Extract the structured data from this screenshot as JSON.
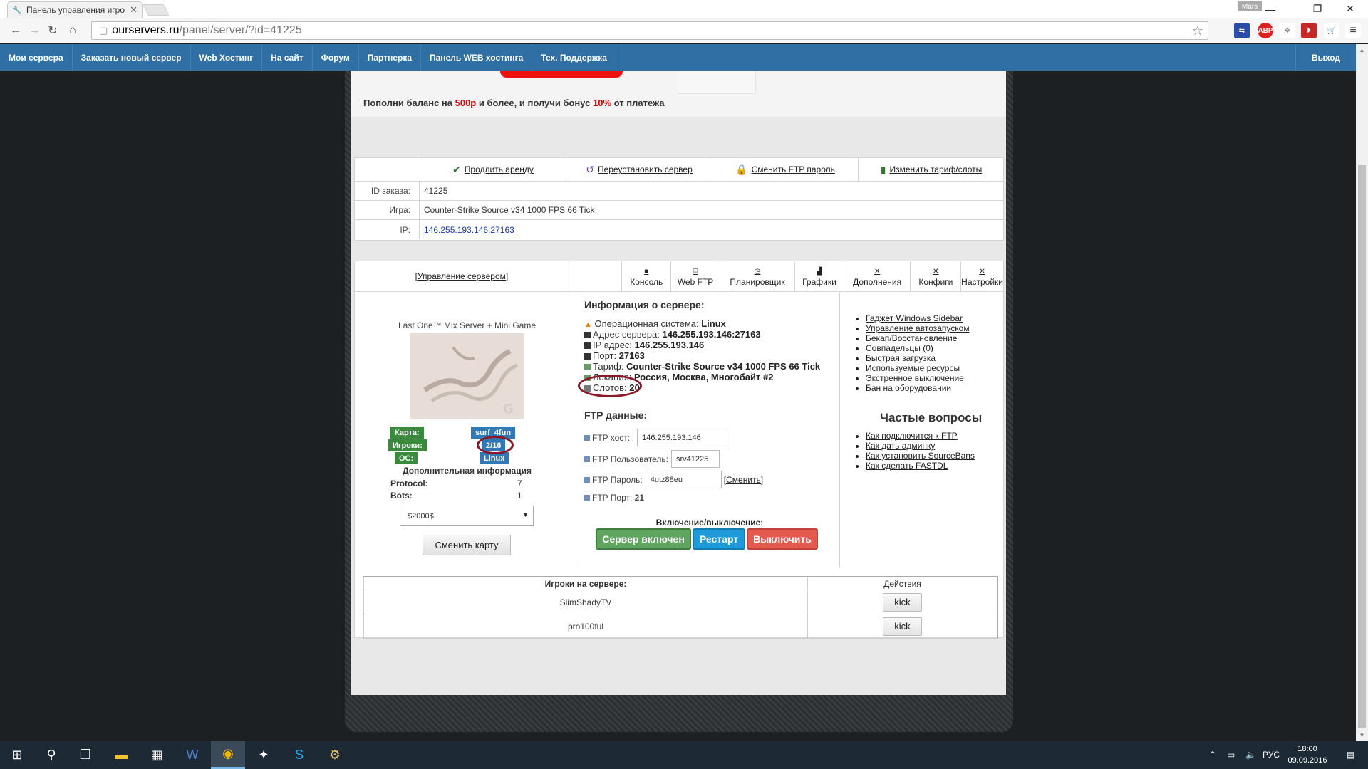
{
  "browser": {
    "tab_title": "Панель управления игро",
    "user_chip": "Mars",
    "url_host": "ourservers.ru",
    "url_path": "/panel/server/?id=41225"
  },
  "nav": {
    "items": [
      "Мои сервера",
      "Заказать новый сервер",
      "Web Хостинг",
      "На сайт",
      "Форум",
      "Партнерка",
      "Панель WEB хостинга",
      "Тех. Поддержка"
    ],
    "logout": "Выход"
  },
  "promo": {
    "text_a": "Пополни баланс на ",
    "amount": "500р",
    "text_b": " и более, и получи бонус ",
    "percent": "10%",
    "text_c": " от платежа"
  },
  "actions": [
    "Продлить аренду",
    "Переустановить сервер",
    "Сменить FTP пароль",
    "Изменить тариф/слоты"
  ],
  "order": {
    "id_label": "ID заказа:",
    "id_value": "41225",
    "game_label": "Игра:",
    "game_value": "Counter-Strike Source v34 1000 FPS 66 Tick",
    "ip_label": "IP:",
    "ip_value": "146.255.193.146:27163"
  },
  "control_tabs": {
    "manage": "[Управление сервером]",
    "tabs": [
      "Консоль",
      "Web FTP",
      "Планировщик",
      "Графики",
      "Дополнения",
      "Конфиги",
      "Настройки"
    ]
  },
  "status": {
    "server_name": "Last One™ Mix Server + Mini Game",
    "map_label": "Карта:",
    "map_value": "surf_4fun",
    "players_label": "Игроки:",
    "players_value": "2/16",
    "os_label": "ОС:",
    "os_value": "Linux",
    "extra_title": "Дополнительная информация",
    "protocol_label": "Protocol:",
    "protocol_value": "7",
    "bots_label": "Bots:",
    "bots_value": "1",
    "map_select": "$2000$",
    "change_map": "Сменить карту"
  },
  "server_info": {
    "title": "Информация о сервере:",
    "lines": [
      {
        "label": "Операционная система: ",
        "value": "Linux"
      },
      {
        "label": "Адрес сервера: ",
        "value": "146.255.193.146:27163"
      },
      {
        "label": "IP адрес: ",
        "value": "146.255.193.146"
      },
      {
        "label": "Порт: ",
        "value": "27163"
      },
      {
        "label": "Тариф: ",
        "value": "Counter-Strike Source v34 1000 FPS 66 Tick"
      },
      {
        "label": "Локация: ",
        "value": "Россия, Москва, Многобайт #2"
      },
      {
        "label": "Слотов: ",
        "value": "20"
      }
    ]
  },
  "ftp": {
    "title": "FTP данные:",
    "host_label": "FTP хост:",
    "host_value": "146.255.193.146",
    "user_label": "FTP Пользователь:",
    "user_value": "srv41225",
    "pass_label": "FTP Пароль:",
    "pass_value": "4utz88eu",
    "pass_change": "[Сменить]",
    "port_label": "FTP Порт: ",
    "port_value": "21"
  },
  "power": {
    "title": "Включение/выключение:",
    "on": "Сервер включен",
    "restart": "Рестарт",
    "off": "Выключить"
  },
  "right_links": [
    "Гаджет Windows Sidebar",
    "Управление автозапуском",
    "Бекап/Восстановление",
    "Совпадельцы (0)",
    "Быстрая загрузка",
    "Используемые ресурсы",
    "Экстренное выключение",
    "Бан на оборудовании"
  ],
  "faq": {
    "title": "Частые вопросы",
    "links": [
      "Как подключится к FTP",
      "Как дать админку",
      "Как установить SourceBans",
      "Как сделать FASTDL"
    ]
  },
  "players": {
    "col_players": "Игроки на сервере:",
    "col_actions": "Действия",
    "rows": [
      {
        "name": "SlimShadyTV",
        "action": "kick"
      },
      {
        "name": "pro100ful",
        "action": "kick"
      }
    ]
  },
  "taskbar": {
    "lang": "РУС",
    "time": "18:00",
    "date": "09.09.2016"
  },
  "colors": {
    "nav_bg": "#2f6fa4",
    "tag_green": "#3a8a3e",
    "tag_blue": "#2f79b7",
    "btn_on": "#5fa55f",
    "btn_restart": "#1f9ad9",
    "btn_off": "#e55a4f",
    "highlight": "#8a1a2a"
  }
}
